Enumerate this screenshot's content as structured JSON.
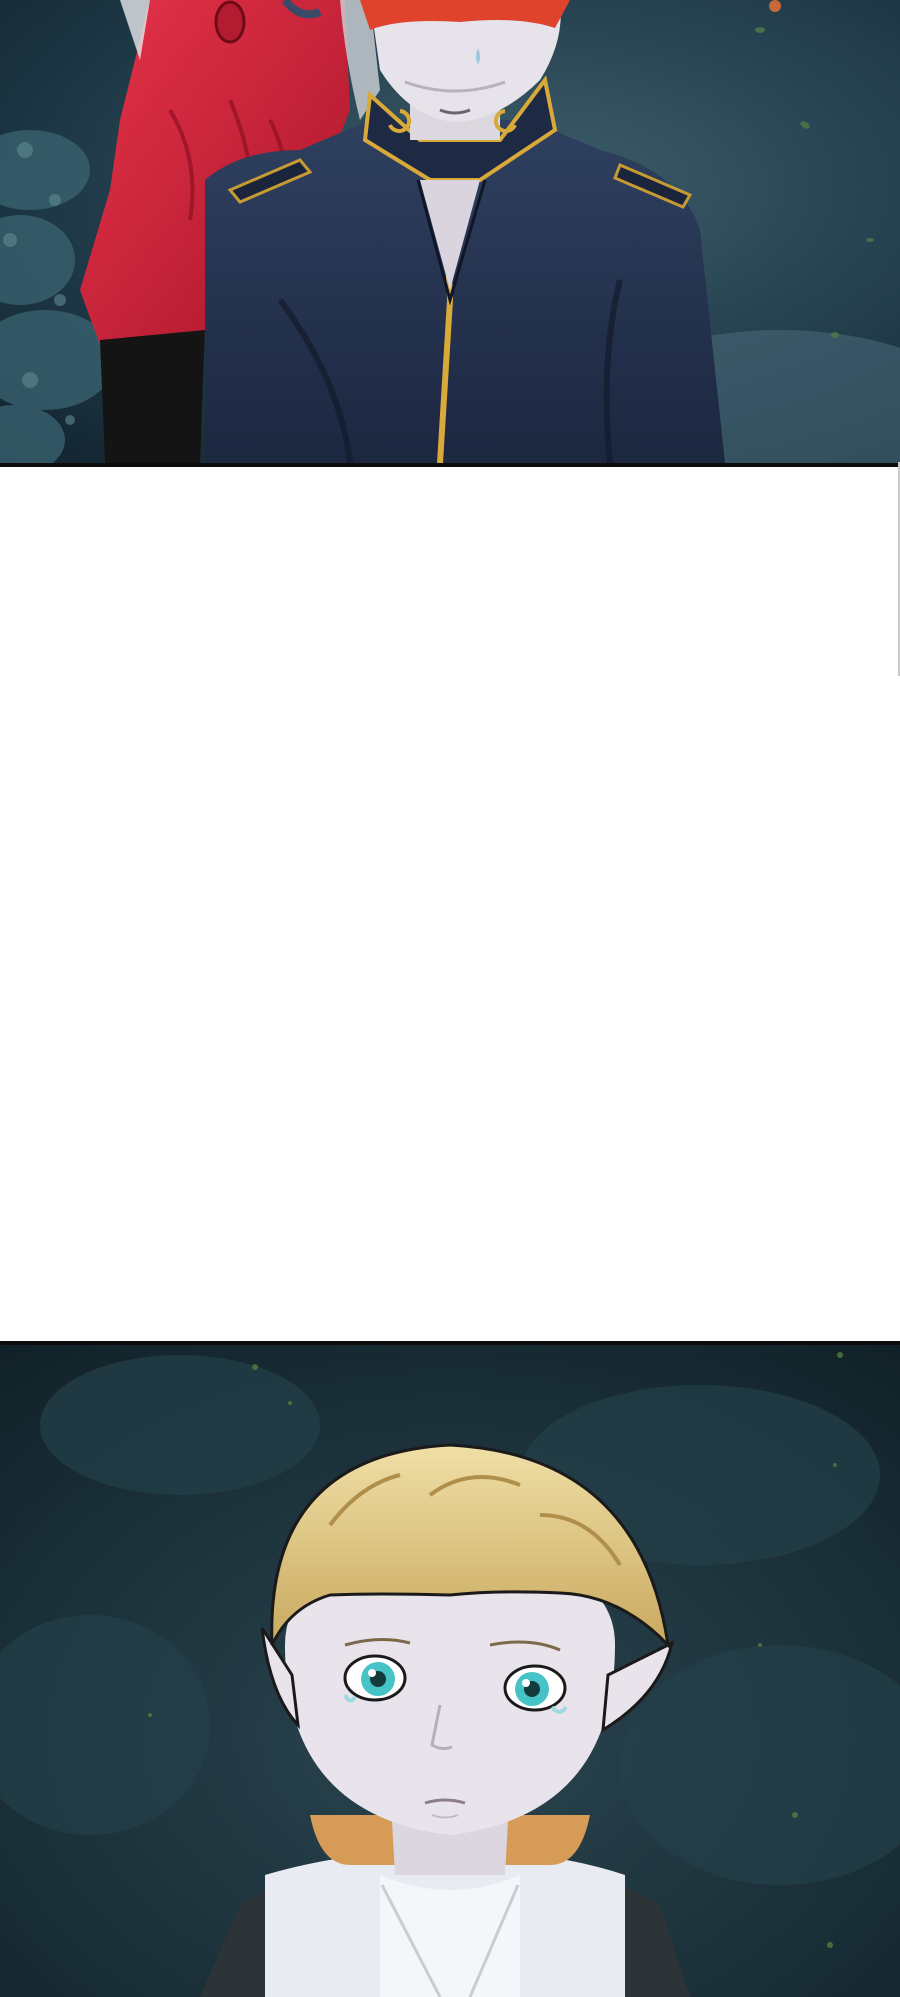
{
  "reader": {
    "background": "#ffffff",
    "panels": [
      {
        "name": "panel-top",
        "palette": {
          "night_bg": "#1b3443",
          "foliage": "#2f5563",
          "cloak_red": "#d3223a",
          "uniform_navy": "#27364f",
          "gold_trim": "#d9a93a",
          "hair_red": "#e0432c",
          "skin": "#e6e3ea"
        }
      },
      {
        "name": "panel-bottom",
        "palette": {
          "night_bg": "#14272d",
          "hair_blond": "#e4cc8c",
          "hair_ginger": "#d69b56",
          "skin": "#e9e4ec",
          "eyes": "#46c3c6",
          "tunic": "#e8ecf2",
          "vest": "#2c3438"
        }
      }
    ]
  }
}
